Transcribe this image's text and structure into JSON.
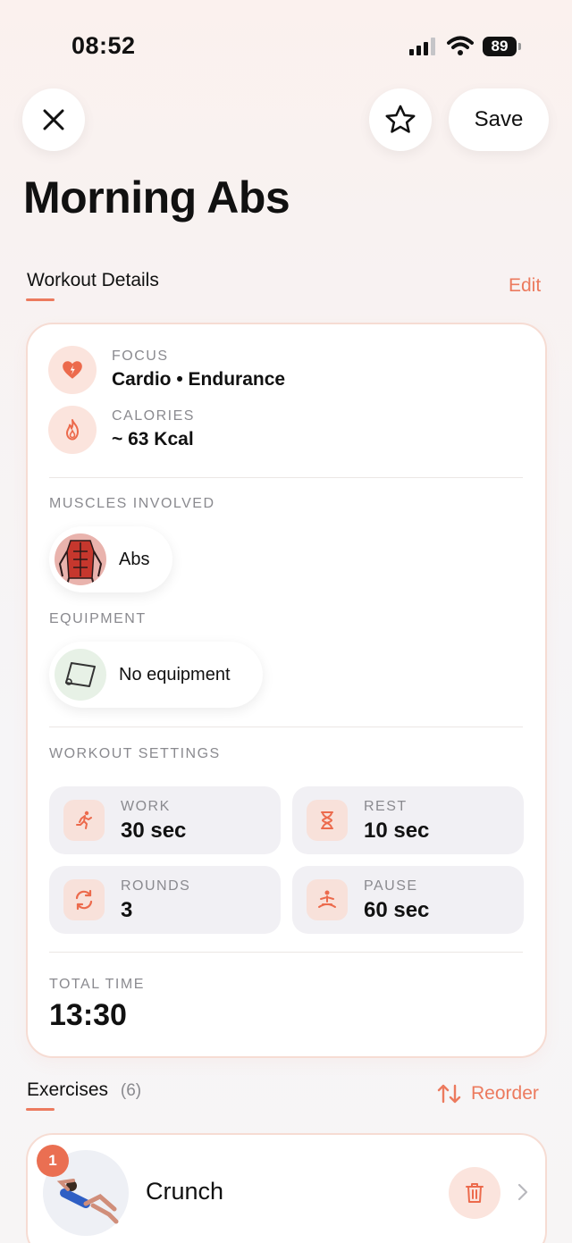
{
  "status_bar": {
    "time": "08:52",
    "battery": "89"
  },
  "header": {
    "save_label": "Save",
    "title": "Morning Abs"
  },
  "details": {
    "section_label": "Workout Details",
    "edit_label": "Edit",
    "focus": {
      "caption": "FOCUS",
      "value": "Cardio • Endurance"
    },
    "calories": {
      "caption": "CALORIES",
      "value": "~ 63 Kcal"
    },
    "muscles": {
      "caption": "MUSCLES INVOLVED",
      "chip": "Abs"
    },
    "equipment": {
      "caption": "EQUIPMENT",
      "chip": "No equipment"
    },
    "settings": {
      "caption": "WORKOUT SETTINGS",
      "work": {
        "caption": "WORK",
        "value": "30 sec"
      },
      "rest": {
        "caption": "REST",
        "value": "10 sec"
      },
      "rounds": {
        "caption": "ROUNDS",
        "value": "3"
      },
      "pause": {
        "caption": "PAUSE",
        "value": "60 sec"
      }
    },
    "total": {
      "caption": "TOTAL TIME",
      "value": "13:30"
    }
  },
  "exercises": {
    "section_label": "Exercises",
    "count": "(6)",
    "reorder_label": "Reorder",
    "items": [
      {
        "number": "1",
        "name": "Crunch"
      }
    ]
  },
  "colors": {
    "accent": "#ec7a5e",
    "badge_bg": "#fbe4dd",
    "tile_bg": "#f1f0f4"
  },
  "icons": [
    "close-icon",
    "star-icon",
    "heart-bolt-icon",
    "flame-icon",
    "run-icon",
    "hourglass-icon",
    "repeat-icon",
    "meditate-icon",
    "sort-icon",
    "trash-icon",
    "chevron-right-icon"
  ]
}
